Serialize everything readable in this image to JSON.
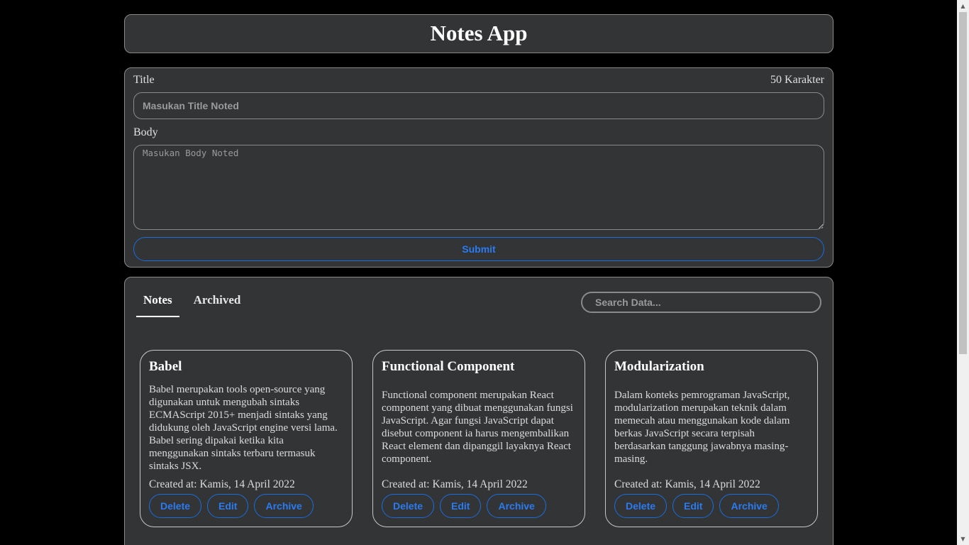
{
  "app": {
    "title": "Notes App"
  },
  "form": {
    "title_label": "Title",
    "char_counter": "50 Karakter",
    "title_placeholder": "Masukan Title Noted",
    "body_label": "Body",
    "body_placeholder": "Masukan Body Noted",
    "submit_label": "Submit"
  },
  "tabs": [
    {
      "label": "Notes",
      "active": true
    },
    {
      "label": "Archived",
      "active": false
    }
  ],
  "search": {
    "placeholder": "Search Data..."
  },
  "notes": [
    {
      "title": "Babel",
      "body": "Babel merupakan tools open-source yang digunakan untuk mengubah sintaks ECMAScript 2015+ menjadi sintaks yang didukung oleh JavaScript engine versi lama. Babel sering dipakai ketika kita menggunakan sintaks terbaru termasuk sintaks JSX.",
      "created": "Created at: Kamis, 14 April 2022"
    },
    {
      "title": "Functional Component",
      "body": "Functional component merupakan React component yang dibuat menggunakan fungsi JavaScript. Agar fungsi JavaScript dapat disebut component ia harus mengembalikan React element dan dipanggil layaknya React component.",
      "created": "Created at: Kamis, 14 April 2022"
    },
    {
      "title": "Modularization",
      "body": "Dalam konteks pemrograman JavaScript, modularization merupakan teknik dalam memecah atau menggunakan kode dalam berkas JavaScript secara terpisah berdasarkan tanggung jawabnya masing-masing.",
      "created": "Created at: Kamis, 14 April 2022"
    }
  ],
  "note_actions": {
    "delete": "Delete",
    "edit": "Edit",
    "archive": "Archive"
  },
  "colors": {
    "background": "#000000",
    "panel": "#333436",
    "accent": "#2a7bf0",
    "border": "#8a8a8a"
  }
}
